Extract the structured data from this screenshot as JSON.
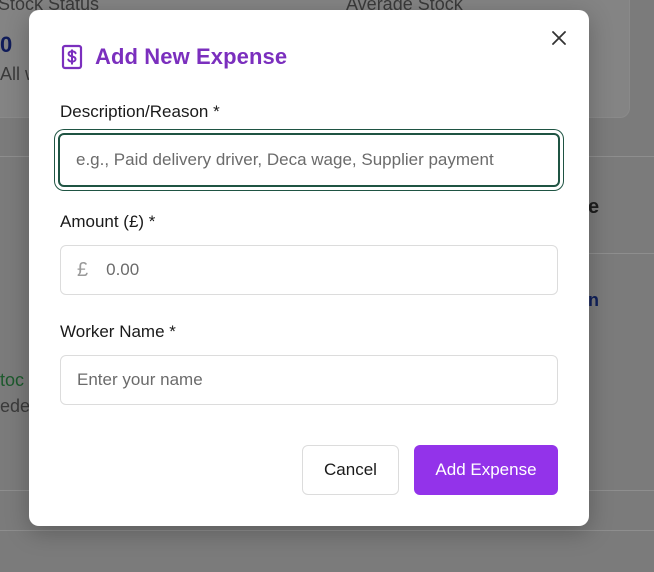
{
  "background": {
    "stock_status_label": "Stock Status",
    "average_stock_label": "Average Stock",
    "stock_value": "0",
    "all_label": "All w",
    "stock_green": "toc",
    "needed_text": "ede",
    "right_heading": "e",
    "right_link": "n"
  },
  "modal": {
    "title": "Add New Expense",
    "close_icon": "close-icon",
    "header_icon": "dollar-receipt-icon",
    "accent_color": "#7b2fbe",
    "fields": {
      "description": {
        "label": "Description/Reason *",
        "placeholder": "e.g., Paid delivery driver, Deca wage, Supplier payment",
        "value": ""
      },
      "amount": {
        "label": "Amount (£) *",
        "currency_symbol": "£",
        "placeholder": "0.00",
        "value": ""
      },
      "worker": {
        "label": "Worker Name *",
        "placeholder": "Enter your name",
        "value": ""
      }
    },
    "buttons": {
      "cancel": "Cancel",
      "add": "Add Expense",
      "add_color": "#9333ea"
    }
  }
}
